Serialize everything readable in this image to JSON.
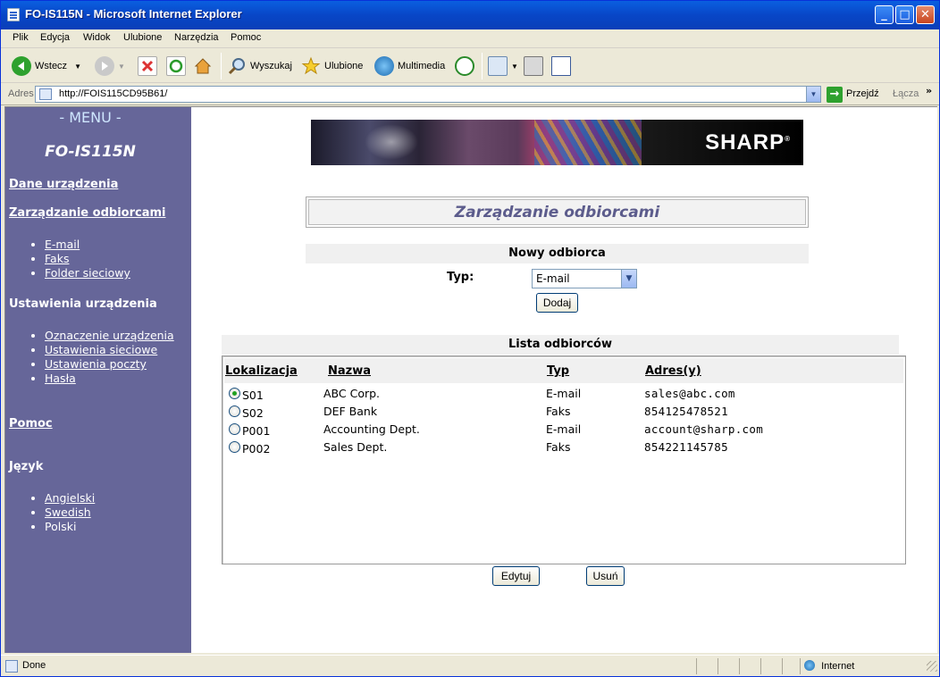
{
  "window": {
    "title": "FO-IS115N - Microsoft Internet Explorer"
  },
  "menubar": [
    "Plik",
    "Edycja",
    "Widok",
    "Ulubione",
    "Narzędzia",
    "Pomoc"
  ],
  "toolbar": {
    "back": "Wstecz",
    "search": "Wyszukaj",
    "favorites": "Ulubione",
    "media": "Multimedia"
  },
  "address": {
    "label": "Adres",
    "url": "http://FOIS115CD95B61/",
    "go": "Przejdź",
    "links": "Łącza"
  },
  "sidebar": {
    "menu": "- MENU -",
    "model": "FO-IS115N",
    "device_data": "Dane urządzenia",
    "recipients": "Zarządzanie odbiorcami",
    "recipient_items": [
      "E-mail",
      "Faks",
      "Folder sieciowy"
    ],
    "device_settings": "Ustawienia urządzenia",
    "setting_items": [
      "Oznaczenie urządzenia",
      "Ustawienia sieciowe",
      "Ustawienia poczty",
      "Hasła"
    ],
    "help": "Pomoc",
    "language": "Język",
    "language_items": [
      "Angielski",
      "Swedish",
      "Polski"
    ]
  },
  "main": {
    "brand": "SHARP",
    "brand_mark": "®",
    "page_title": "Zarządzanie odbiorcami",
    "new_recipient": "Nowy odbiorca",
    "type_label": "Typ:",
    "type_selected": "E-mail",
    "add_button": "Dodaj",
    "list_title": "Lista odbiorców",
    "columns": [
      "Lokalizacja",
      "Nazwa",
      "Typ",
      "Adres(y)"
    ],
    "rows": [
      {
        "loc": "S01",
        "name": "ABC Corp.",
        "type": "E-mail",
        "addr": "sales@abc.com",
        "selected": true
      },
      {
        "loc": "S02",
        "name": "DEF Bank",
        "type": "Faks",
        "addr": "854125478521",
        "selected": false
      },
      {
        "loc": "P001",
        "name": "Accounting Dept.",
        "type": "E-mail",
        "addr": "account@sharp.com",
        "selected": false
      },
      {
        "loc": "P002",
        "name": "Sales Dept.",
        "type": "Faks",
        "addr": "854221145785",
        "selected": false
      }
    ],
    "edit_button": "Edytuj",
    "delete_button": "Usuń"
  },
  "status": {
    "text": "Done",
    "zone": "Internet"
  }
}
